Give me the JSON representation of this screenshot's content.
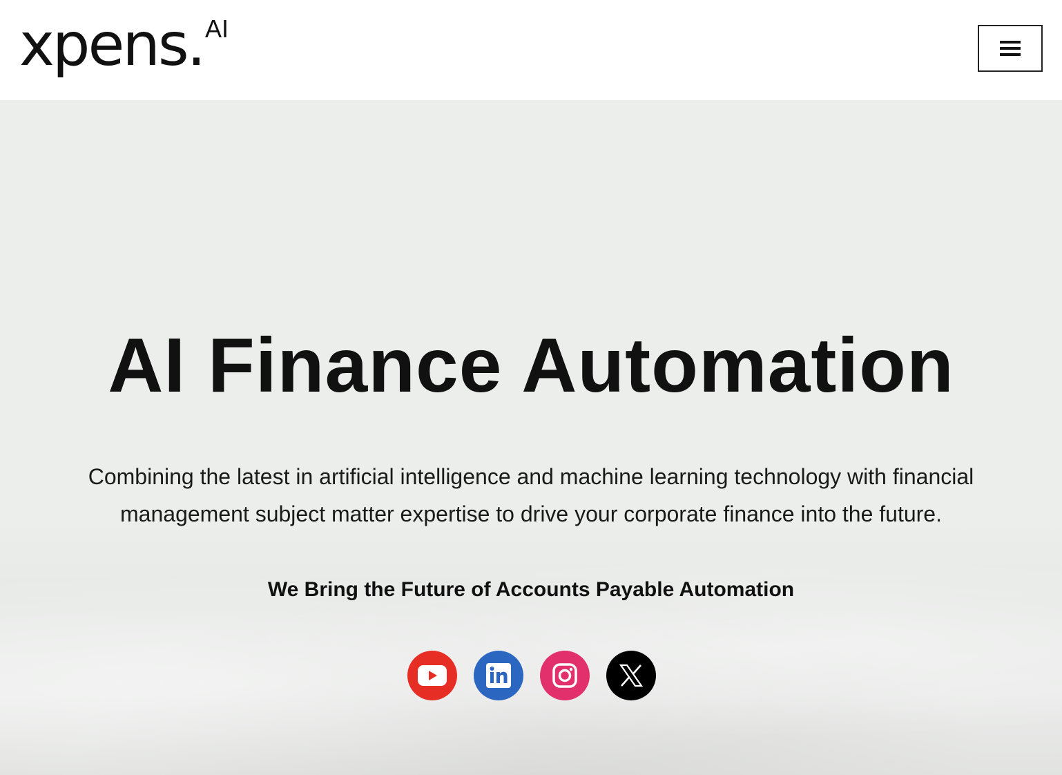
{
  "header": {
    "logo_text": "xpens.",
    "logo_superscript": "AI",
    "menu_button_label": "Menu"
  },
  "hero": {
    "title": "AI Finance Automation",
    "description": "Combining the latest in artificial intelligence and machine learning technology with financial management subject matter expertise to drive your corporate finance into the future.",
    "tagline": "We Bring the Future of Accounts Payable Automation"
  },
  "social": [
    {
      "name": "YouTube",
      "icon": "youtube-icon",
      "color": "#e62e24"
    },
    {
      "name": "LinkedIn",
      "icon": "linkedin-icon",
      "color": "#2b66c0"
    },
    {
      "name": "Instagram",
      "icon": "instagram-icon",
      "color": "#e1306c"
    },
    {
      "name": "X",
      "icon": "x-icon",
      "color": "#000000"
    }
  ],
  "colors": {
    "hero_background": "#eceeec",
    "text": "#111111"
  }
}
